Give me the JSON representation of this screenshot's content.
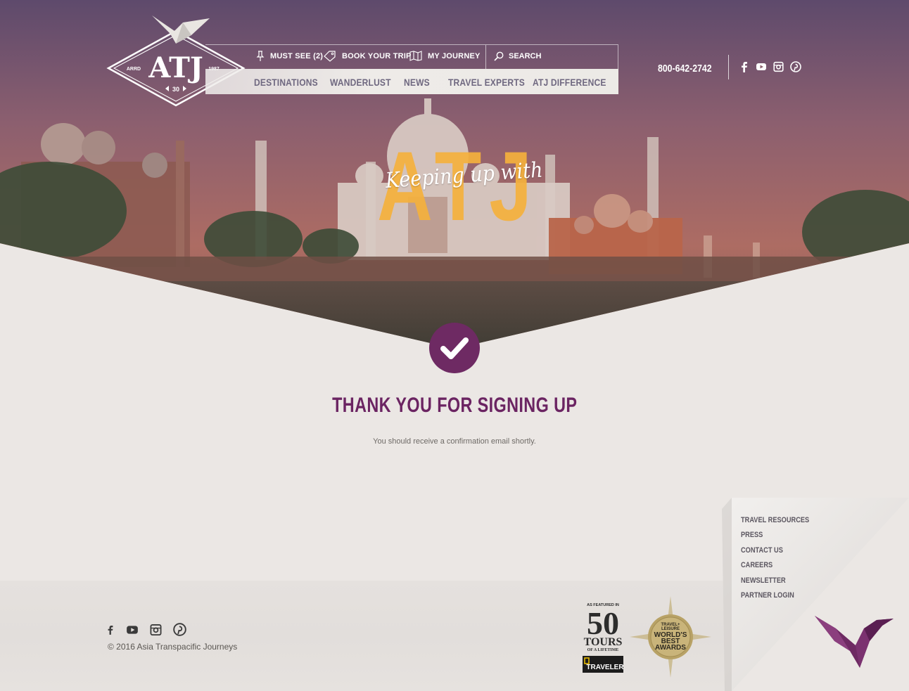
{
  "brand": {
    "logo_text": "ATJ",
    "logo_left": "ARRD",
    "logo_right": "1987",
    "logo_badge": "30"
  },
  "utility_nav": {
    "must_see": "MUST SEE (2)",
    "book_trip": "BOOK YOUR TRIP",
    "my_journey": "MY JOURNEY",
    "search_placeholder": "SEARCH"
  },
  "main_nav": [
    {
      "label": "DESTINATIONS"
    },
    {
      "label": "WANDERLUST"
    },
    {
      "label": "NEWS"
    },
    {
      "label": "TRAVEL EXPERTS"
    },
    {
      "label": "ATJ DIFFERENCE"
    }
  ],
  "header": {
    "phone": "800-642-2742",
    "social_icons": [
      "facebook-icon",
      "youtube-icon",
      "instagram-icon",
      "pinterest-icon"
    ]
  },
  "hero": {
    "script_text": "Keeping up with",
    "big_text": "ATJ"
  },
  "message": {
    "title": "THANK YOU FOR SIGNING UP",
    "subtitle": "You should receive a confirmation email shortly."
  },
  "footer": {
    "copyright": "© 2016 Asia Transpacific Journeys",
    "links": [
      {
        "label": "TRAVEL RESOURCES"
      },
      {
        "label": "PRESS"
      },
      {
        "label": "CONTACT US"
      },
      {
        "label": "CAREERS"
      },
      {
        "label": "NEWSLETTER"
      },
      {
        "label": "PARTNER LOGIN"
      }
    ],
    "badge_50": {
      "top": "AS FEATURED IN",
      "number": "50",
      "line1": "TOURS",
      "line2": "OF A LIFETIME",
      "brand": "TRAVELER"
    },
    "badge_tl": {
      "line1": "TRAVEL+",
      "line2": "LEISURE",
      "line3": "WORLD'S",
      "line4": "BEST",
      "line5": "AWARDS"
    }
  },
  "colors": {
    "accent_purple": "#6e2a63",
    "title_purple": "#6b2462",
    "hero_yellow": "#f5b13d",
    "page_bg": "#ebe7e4"
  }
}
